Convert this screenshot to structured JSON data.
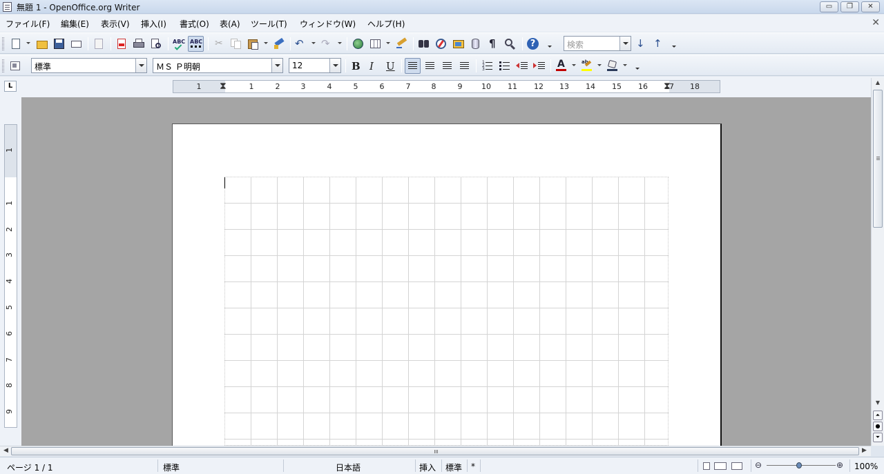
{
  "window": {
    "title": "無題 1 - OpenOffice.org Writer",
    "minimize": "▭",
    "restore": "❐",
    "close": "✕"
  },
  "menu": {
    "items": [
      "ファイル(F)",
      "編集(E)",
      "表示(V)",
      "挿入(I)",
      "書式(O)",
      "表(A)",
      "ツール(T)",
      "ウィンドウ(W)",
      "ヘルプ(H)"
    ],
    "doc_close": "✕"
  },
  "toolbar": {
    "search_placeholder": "検索",
    "icons": [
      "new-document-icon",
      "open-folder-icon",
      "save-icon",
      "email-icon",
      "edit-file-icon",
      "export-pdf-icon",
      "print-icon",
      "page-preview-icon",
      "spellcheck-icon",
      "autospellcheck-icon",
      "cut-icon",
      "copy-icon",
      "paste-icon",
      "clone-formatting-icon",
      "undo-icon",
      "redo-icon",
      "hyperlink-icon",
      "table-icon",
      "show-draw-functions-icon",
      "find-replace-icon",
      "navigator-icon",
      "gallery-icon",
      "data-sources-icon",
      "formatting-marks-icon",
      "zoom-icon",
      "help-icon",
      "find-next-icon",
      "find-previous-icon"
    ]
  },
  "formatting": {
    "style": "標準",
    "font": "ＭＳ Ｐ明朝",
    "size": "12",
    "bold": "B",
    "italic": "I",
    "underline": "U",
    "font_color_letter": "A",
    "colors": {
      "font_color": "#c00000",
      "highlight": "#ffff00"
    }
  },
  "ruler": {
    "horizontal_labels": [
      "1",
      "1",
      "2",
      "3",
      "4",
      "5",
      "6",
      "7",
      "8",
      "9",
      "10",
      "11",
      "12",
      "13",
      "14",
      "15",
      "16",
      "17",
      "18"
    ],
    "vertical_labels": [
      "1",
      "1",
      "2",
      "3",
      "4",
      "5",
      "6",
      "7",
      "8",
      "9"
    ],
    "tab_button": "L"
  },
  "status": {
    "page": "ページ 1 / 1",
    "style": "標準",
    "language": "日本語",
    "insert_mode": "挿入",
    "selection_mode": "標準",
    "modified": "*",
    "zoom": "100%"
  }
}
